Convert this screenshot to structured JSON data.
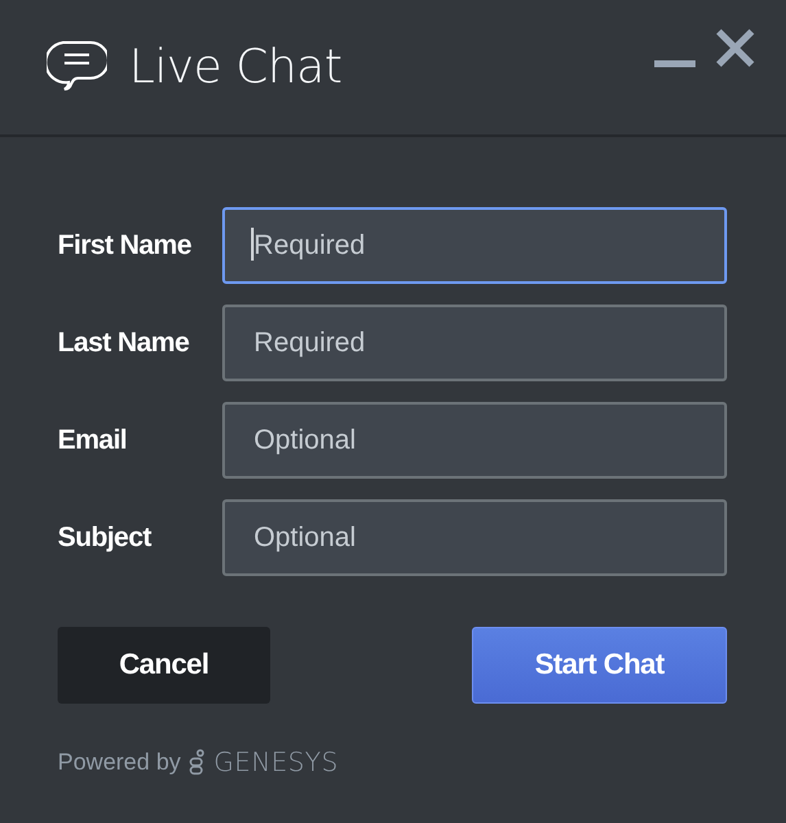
{
  "window": {
    "title": "Live Chat"
  },
  "fields": [
    {
      "label": "First Name",
      "placeholder": "Required",
      "focused": true
    },
    {
      "label": "Last Name",
      "placeholder": "Required",
      "focused": false
    },
    {
      "label": "Email",
      "placeholder": "Optional",
      "focused": false
    },
    {
      "label": "Subject",
      "placeholder": "Optional",
      "focused": false
    }
  ],
  "buttons": [
    {
      "label": "Cancel",
      "kind": "secondary"
    },
    {
      "label": "Start Chat",
      "kind": "primary"
    }
  ],
  "footer": {
    "text": "Powered by",
    "brand": "GENESYS"
  }
}
